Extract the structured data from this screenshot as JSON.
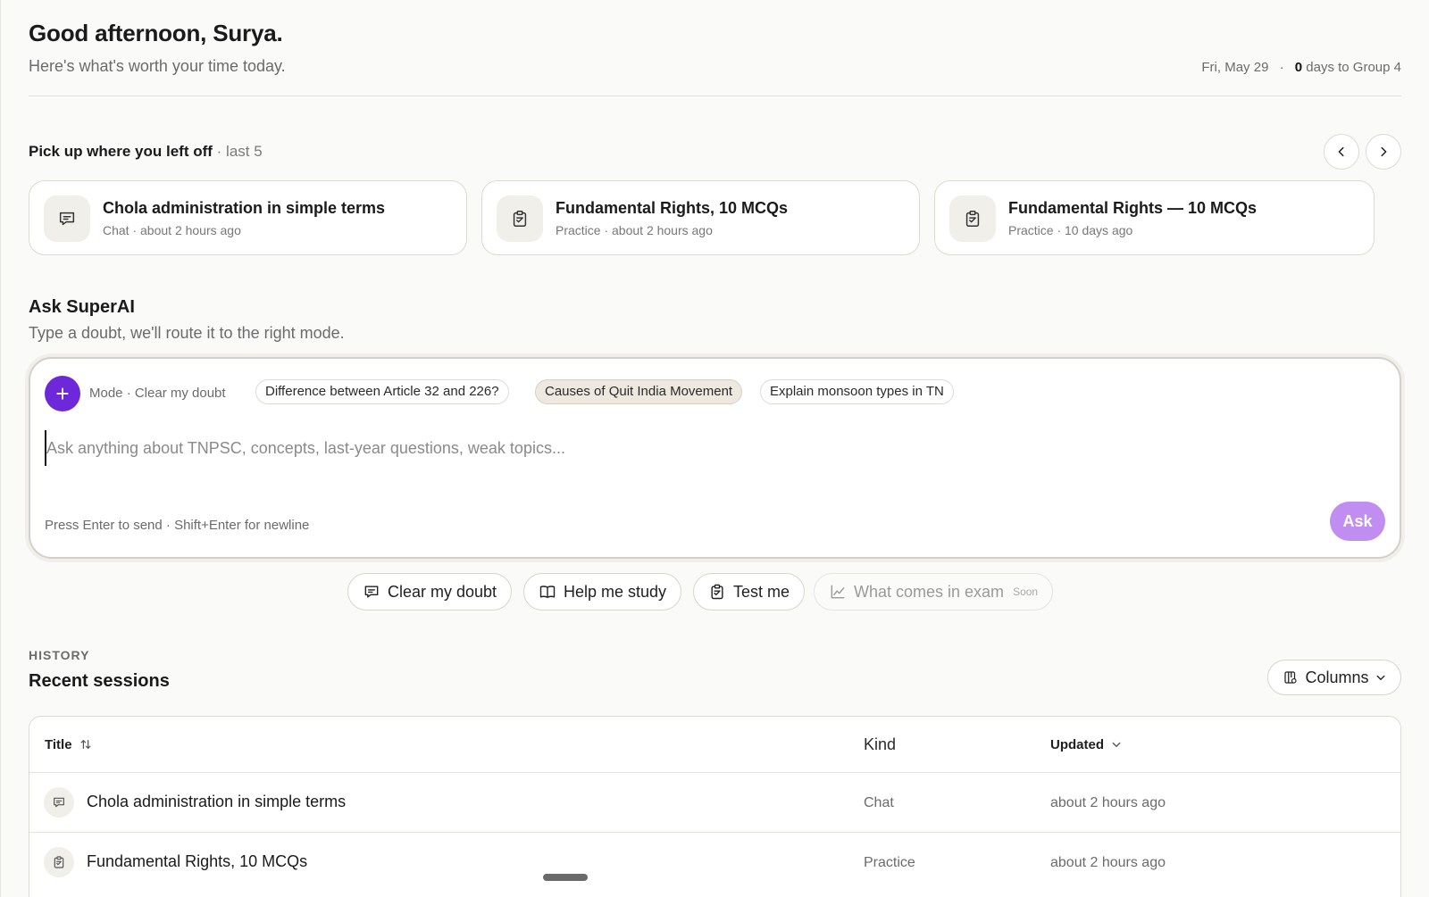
{
  "header": {
    "greeting": "Good afternoon, Surya.",
    "subtitle": "Here's what's worth your time today.",
    "date": "Fri, May 29",
    "separator": "·",
    "days_count": "0",
    "days_text": "days to Group 4"
  },
  "pickup": {
    "title": "Pick up where you left off",
    "suffix": "· last 5",
    "cards": [
      {
        "title": "Chola administration in simple terms",
        "meta": "Chat · about 2 hours ago",
        "icon": "chat-icon"
      },
      {
        "title": "Fundamental Rights, 10 MCQs",
        "meta": "Practice · about 2 hours ago",
        "icon": "clipboard-check-icon"
      },
      {
        "title": "Fundamental Rights — 10 MCQs",
        "meta": "Practice · 10 days ago",
        "icon": "clipboard-check-icon"
      }
    ]
  },
  "ask": {
    "title": "Ask SuperAI",
    "subtitle": "Type a doubt, we'll route it to the right mode.",
    "mode_label": "Mode · Clear my doubt",
    "chips": [
      "Difference between Article 32 and 226?",
      "Causes of Quit India Movement",
      "Explain monsoon types in TN"
    ],
    "active_chip": "Causes of Quit India Movement",
    "placeholder": "Ask anything about TNPSC, concepts, last-year questions, weak topics...",
    "hint": "Press Enter to send · Shift+Enter for newline",
    "ask_label": "Ask"
  },
  "modes": [
    {
      "label": "Clear my doubt",
      "icon": "chat-icon"
    },
    {
      "label": "Help me study",
      "icon": "book-icon"
    },
    {
      "label": "Test me",
      "icon": "clipboard-check-icon"
    },
    {
      "label": "What comes in exam",
      "icon": "trend-chart-icon",
      "badge": "Soon",
      "disabled": true
    }
  ],
  "history": {
    "label": "HISTORY",
    "title": "Recent sessions",
    "columns_label": "Columns",
    "headers": {
      "title": "Title",
      "kind": "Kind",
      "updated": "Updated"
    },
    "rows": [
      {
        "title": "Chola administration in simple terms",
        "kind": "Chat",
        "updated": "about 2 hours ago",
        "icon": "chat-icon"
      },
      {
        "title": "Fundamental Rights, 10 MCQs",
        "kind": "Practice",
        "updated": "about 2 hours ago",
        "icon": "clipboard-check-icon"
      }
    ]
  },
  "colors": {
    "accent": "#6d28d9",
    "ask_button": "#bf8ef0",
    "background": "#fafaf8"
  }
}
